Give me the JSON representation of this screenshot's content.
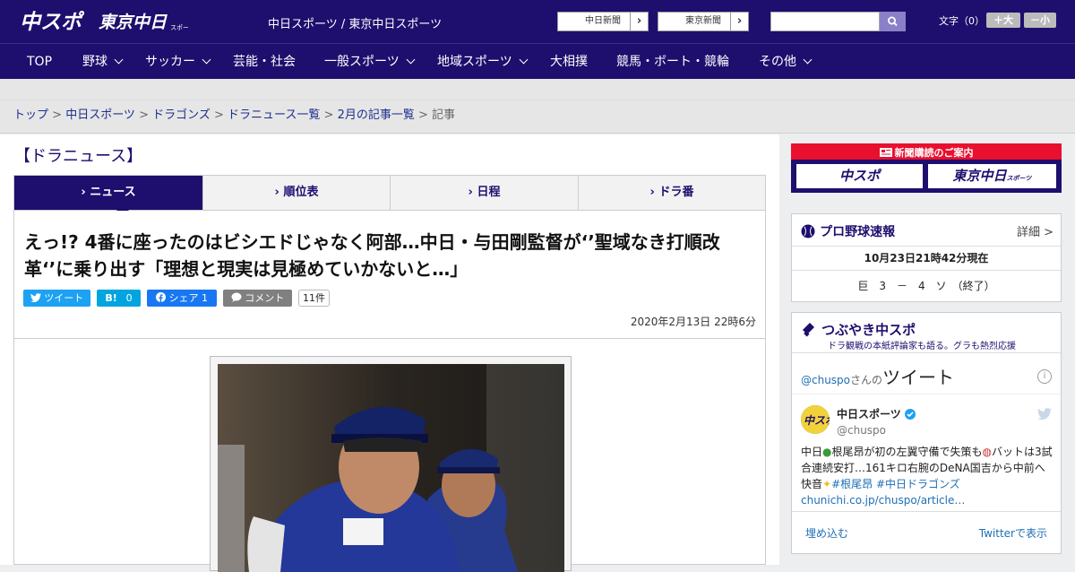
{
  "header": {
    "logo_chuspo": "中スポ",
    "logo_tokyo": "東京中日",
    "logo_tokyo_small": "スポーツ",
    "site_links": "中日スポーツ / 東京中日スポーツ",
    "newspaper_buttons": [
      "中日新聞",
      "東京新聞"
    ],
    "arrow": "›",
    "font_size_label": "文字（0）",
    "font_increase": "＋大",
    "font_decrease": "－小"
  },
  "nav": {
    "items": [
      "TOP",
      "野球",
      "サッカー",
      "芸能・社会",
      "一般スポーツ",
      "地域スポーツ",
      "大相撲",
      "競馬・ボート・競輪",
      "その他"
    ]
  },
  "breadcrumb": {
    "items": [
      "トップ",
      "中日スポーツ",
      "ドラゴンズ",
      "ドラニュース一覧",
      "2月の記事一覧"
    ],
    "current": "記事",
    "sep": " > "
  },
  "section_title": "【ドラニュース】",
  "tabs": [
    "ニュース",
    "順位表",
    "日程",
    "ドラ番"
  ],
  "article": {
    "headline": "えっ!? 4番に座ったのはビシエドじゃなく阿部…中日・与田剛監督が‘’聖域なき打順改革‘’に乗り出す「理想と現実は見極めていかないと…」",
    "share": {
      "tweet": "ツイート",
      "hatena_label": "B!",
      "hatena_count": "0",
      "facebook_label": "シェア",
      "facebook_count": "1",
      "comment_label": "コメント",
      "comment_count": "11件"
    },
    "date": "2020年2月13日 22時6分"
  },
  "sidebar": {
    "subscription_heading": "新聞購読のご案内",
    "subscription_buttons": [
      "中スポ",
      "東京中日"
    ],
    "subscription_small": "スポーツ",
    "baseball": {
      "title": "プロ野球速報",
      "more": "詳細 >",
      "updated": "10月23日21時42分現在",
      "score": "巨　3　－　4　ソ　（終了）"
    },
    "tsubuyaki": {
      "title": "つぶやき中スポ",
      "subtitle": "ドラ観戦の本紙評論家も語る。グラも熱烈応援",
      "handle_prefix": "@chuspo",
      "handle_suffix": "さんの",
      "tweet_word": "ツイート",
      "account_name": "中日スポーツ",
      "account_handle": "@chuspo",
      "tweet_text_1": "中日",
      "tweet_text_2": "根尾昂が初の左翼守備で失策も",
      "tweet_text_3": "バットは3試合連続安打…161キロ右腕のDeNA国吉から中前へ快音",
      "tweet_tags": "#根尾昂 #中日ドラゴンズ",
      "tweet_link": "chunichi.co.jp/chuspo/article…",
      "embed": "埋め込む",
      "view_on_twitter": "Twitterで表示"
    }
  },
  "colors": {
    "brand_navy": "#1e0e6e",
    "twitter": "#1da1f2",
    "hatena": "#00a4de",
    "facebook": "#1877f2",
    "subscription_red": "#e8102e"
  }
}
